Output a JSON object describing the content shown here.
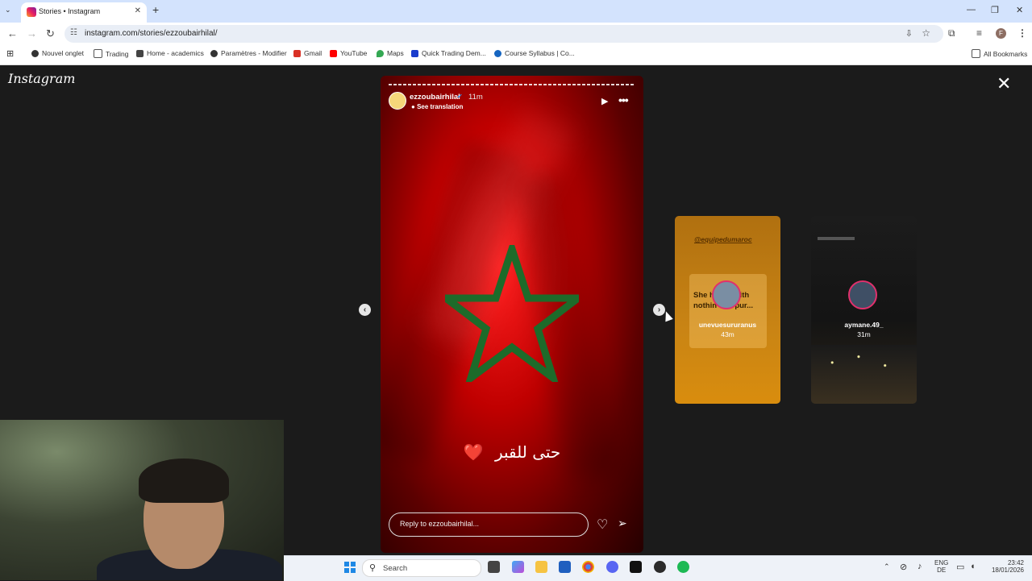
{
  "browser": {
    "tab_title": "Stories • Instagram",
    "url": "instagram.com/stories/ezzoubairhilal/",
    "profile_initial": "F",
    "bookmarks": [
      {
        "label": "Nouvel onglet",
        "icon_color": "#333333"
      },
      {
        "label": "Trading",
        "icon_color": "#555555"
      },
      {
        "label": "Home - academics",
        "icon_color": "#444444"
      },
      {
        "label": "Paramètres - Modifier",
        "icon_color": "#333333"
      },
      {
        "label": "Gmail",
        "icon_color": "#d93025"
      },
      {
        "label": "YouTube",
        "icon_color": "#ff0000"
      },
      {
        "label": "Maps",
        "icon_color": "#34a853"
      },
      {
        "label": "Quick Trading Dem...",
        "icon_color": "#1a3ccc"
      },
      {
        "label": "Course Syllabus | Co...",
        "icon_color": "#1565c0"
      }
    ],
    "all_bookmarks": "All Bookmarks"
  },
  "instagram": {
    "logo": "Instagram",
    "story": {
      "username": "ezzoubairhilal",
      "verified": "✔",
      "time": "11m",
      "see_translation": "See translation",
      "caption_text": "حتى للقبر",
      "caption_heart": "❤️",
      "reply_placeholder": "Reply to ezzoubairhilal..."
    },
    "next_stories": [
      {
        "username": "unevuesururanus",
        "time": "43m",
        "tag": "@equipedumaroc",
        "preview_text": "She hear... with nothin' but pur..."
      },
      {
        "username": "aymane.49_",
        "time": "31m"
      }
    ]
  },
  "taskbar": {
    "search_label": "Search",
    "lang_top": "ENG",
    "lang_bottom": "DE",
    "time": "23:42",
    "date": "18/01/2026"
  }
}
